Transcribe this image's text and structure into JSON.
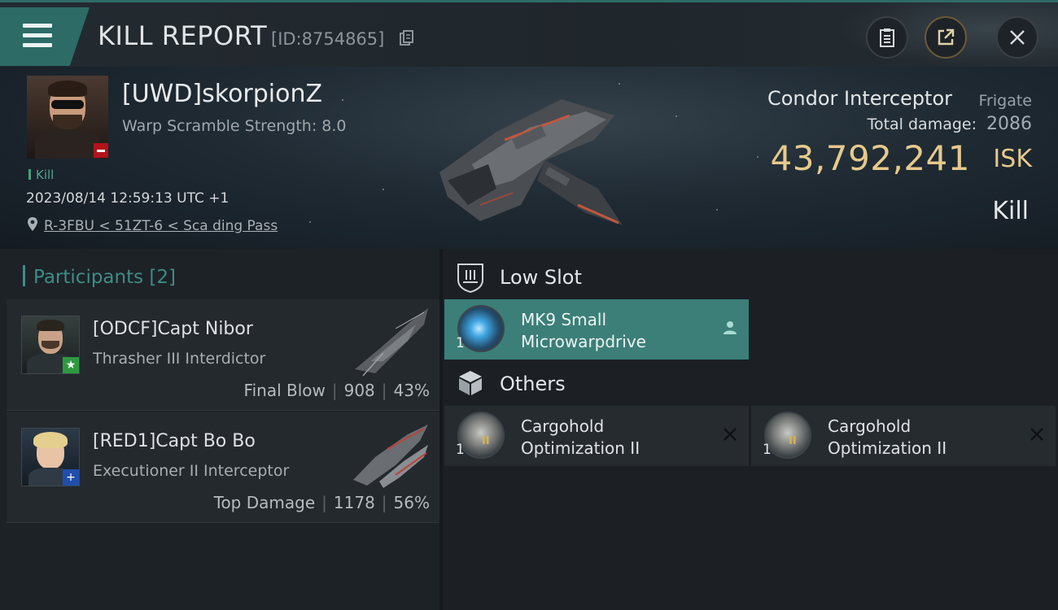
{
  "header": {
    "title": "KILL REPORT",
    "report_id": "[ID:8754865]",
    "icons": [
      "menu-icon",
      "copy-icon",
      "clipboard-icon",
      "share-icon",
      "close-icon"
    ]
  },
  "victim": {
    "name": "[UWD]skorpionZ",
    "warp_scramble": "Warp Scramble Strength: 8.0",
    "tag": "Kill",
    "timestamp": "2023/08/14 12:59:13 UTC +1",
    "location": "R-3FBU < 51ZT-6 < Sca ding Pass",
    "ship_name": "Condor Interceptor",
    "ship_class": "Frigate",
    "total_damage_label": "Total damage:",
    "total_damage": "2086",
    "isk_value": "43,792,241",
    "isk_unit": "ISK",
    "result": "Kill"
  },
  "participants": {
    "title": "Participants",
    "count": "[2]",
    "list": [
      {
        "name": "[ODCF]Capt Nibor",
        "ship": "Thrasher III Interdictor",
        "role": "Final Blow",
        "damage": "908",
        "percent": "43%",
        "badge": "★",
        "badge_color": "#2e9a3f"
      },
      {
        "name": "[RED1]Capt Bo Bo",
        "ship": "Executioner II Interceptor",
        "role": "Top Damage",
        "damage": "1178",
        "percent": "56%",
        "badge": "+",
        "badge_color": "#1f4fae"
      }
    ]
  },
  "fitting": {
    "low_slot_label": "Low Slot",
    "others_label": "Others",
    "low_slot_items": [
      {
        "qty": "1",
        "name_line1": "MK9 Small",
        "name_line2": "Microwarpdrive"
      }
    ],
    "other_items": [
      {
        "qty": "1",
        "name_line1": "Cargohold",
        "name_line2": "Optimization II",
        "tier": "II"
      },
      {
        "qty": "1",
        "name_line1": "Cargohold",
        "name_line2": "Optimization II",
        "tier": "II"
      }
    ]
  },
  "colors": {
    "accent_teal": "#3b7f78",
    "isk_gold": "#e7c98d",
    "danger_red": "#b3131a"
  }
}
